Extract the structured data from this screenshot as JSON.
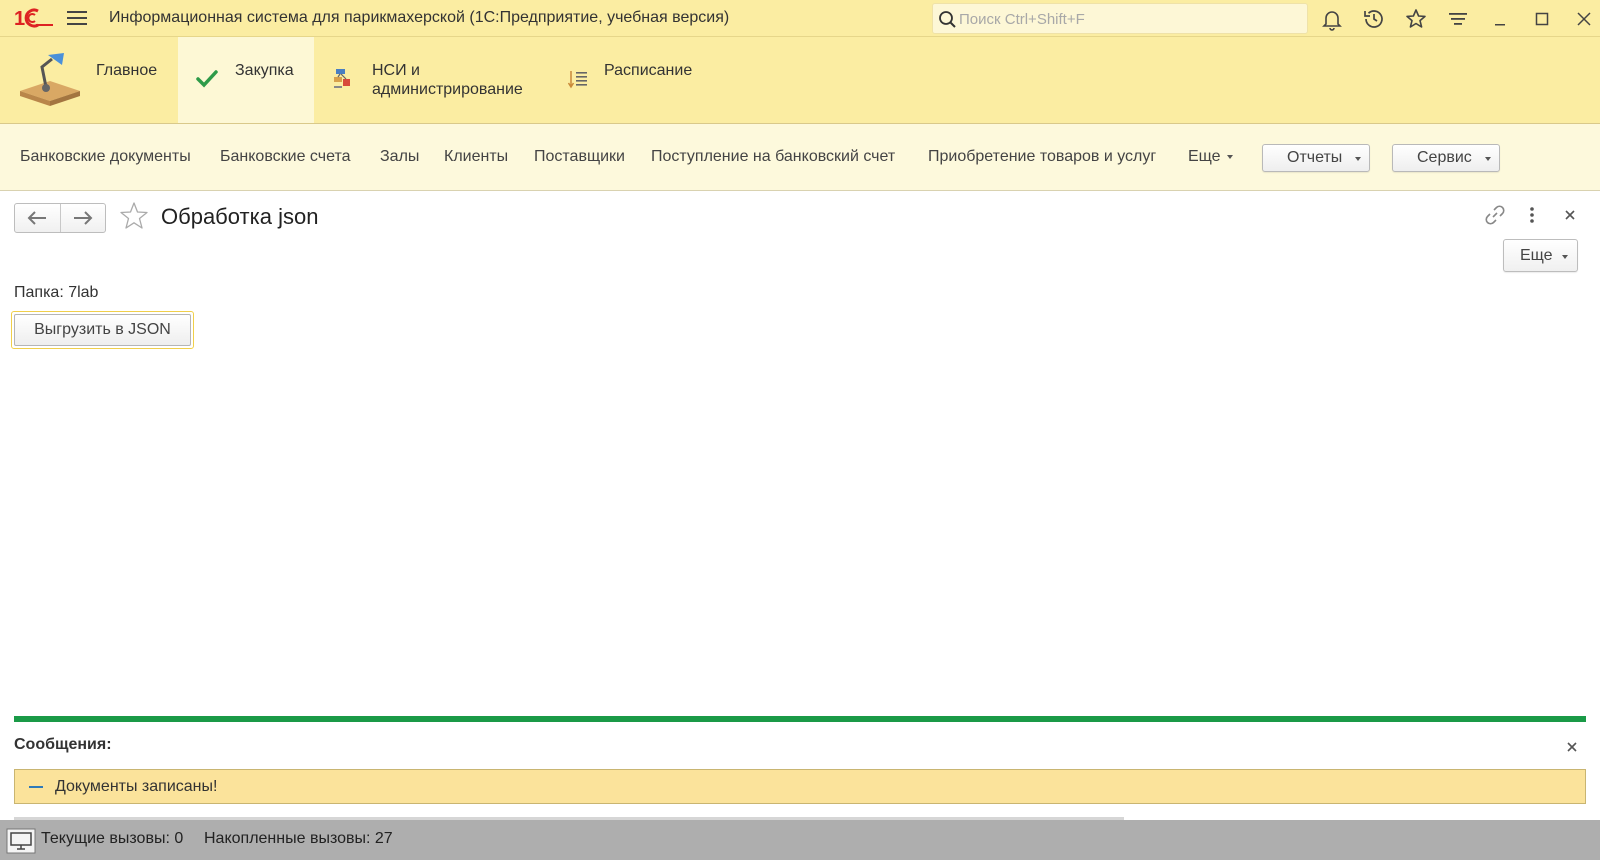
{
  "titlebar": {
    "logo_text": "1С",
    "app_title": "Информационная система для парикмахерской  (1С:Предприятие, учебная версия)",
    "search_placeholder": "Поиск Ctrl+Shift+F",
    "icons": [
      "bell-icon",
      "history-icon",
      "star-icon",
      "menu-lines-icon",
      "minimize-icon",
      "maximize-icon",
      "close-icon"
    ]
  },
  "sections": [
    {
      "label": "Главное",
      "icon": "desk-lamp-icon",
      "active": false
    },
    {
      "label": "Закупка",
      "icon": "checkmark-icon",
      "active": true
    },
    {
      "label_line1": "НСИ и",
      "label_line2": "администрирование",
      "icon": "admin-icon",
      "active": false
    },
    {
      "label": "Расписание",
      "icon": "list-sort-icon",
      "active": false
    }
  ],
  "navpanel": {
    "links": [
      "Банковские документы",
      "Банковские счета",
      "Залы",
      "Клиенты",
      "Поставщики",
      "Поступление на банковский счет",
      "Приобретение товаров и услуг"
    ],
    "more_label": "Еще",
    "reports_label": "Отчеты",
    "service_label": "Сервис"
  },
  "form": {
    "title": "Обработка json",
    "more_label": "Еще",
    "folder_label": "Папка: 7lab",
    "export_button": "Выгрузить в JSON"
  },
  "messages": {
    "title": "Сообщения:",
    "items": [
      "Документы записаны!"
    ],
    "accent_color": "#1a9a47",
    "row_color": "#fbe39b"
  },
  "statusbar": {
    "current_calls": "Текущие вызовы: 0",
    "accumulated_calls": "Накопленные вызовы: 27"
  },
  "colors": {
    "header_bg": "#fbeda2",
    "nav_bg": "#fdf9dc",
    "active_section_bg": "#fdf8d5",
    "status_bg": "#aeaeae"
  }
}
